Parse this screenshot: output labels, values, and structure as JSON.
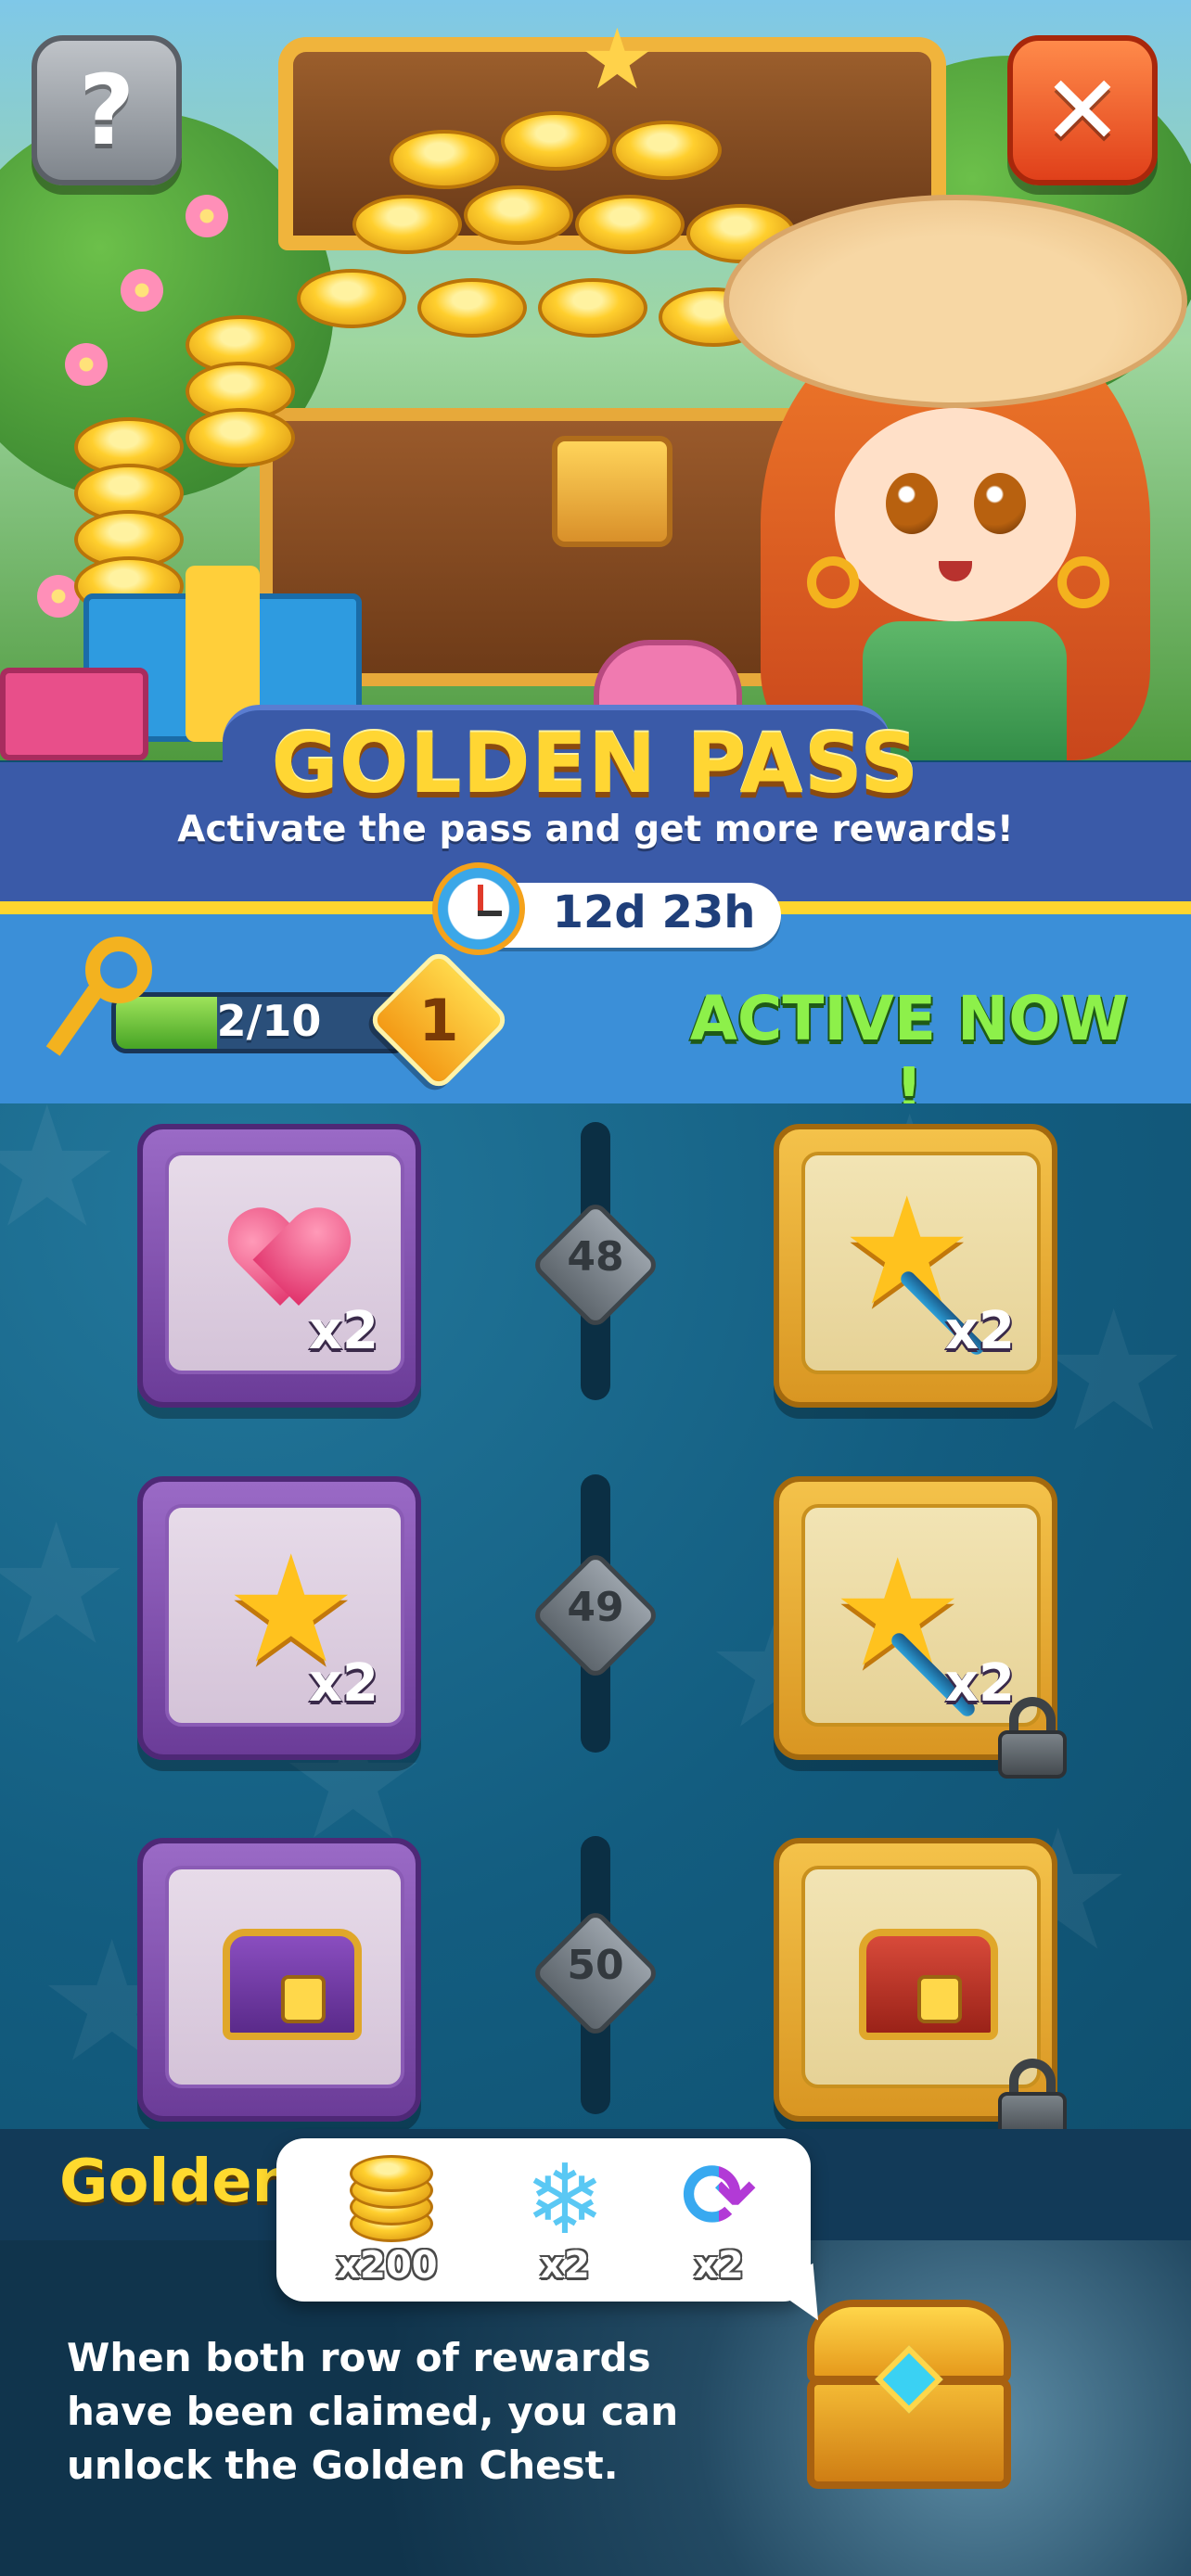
{
  "header": {
    "help_glyph": "?",
    "close_glyph": "✕",
    "title": "GOLDEN PASS",
    "subtitle": "Activate the pass and get more rewards!",
    "timer": "12d 23h"
  },
  "progress": {
    "keys_label": "2/10",
    "keys_fraction": 0.2,
    "level": "1",
    "status": "ACTIVE NOW !"
  },
  "rewards": [
    {
      "level": "48",
      "free": {
        "icon": "heart-icon",
        "qty": "x2"
      },
      "golden": {
        "icon": "star-wand-icon",
        "qty": "x2",
        "locked": false
      }
    },
    {
      "level": "49",
      "free": {
        "icon": "star-icon",
        "qty": "x2"
      },
      "golden": {
        "icon": "star-wand-icon",
        "qty": "x2",
        "locked": true
      }
    },
    {
      "level": "50",
      "free": {
        "icon": "purple-chest-icon",
        "qty": ""
      },
      "golden": {
        "icon": "red-chest-icon",
        "qty": "",
        "locked": true
      }
    }
  ],
  "golden_chest": {
    "label": "Golden",
    "description": "When both row of rewards have been claimed, you can unlock the Golden Chest.",
    "popup_items": [
      {
        "icon": "coins-icon",
        "qty": "x200"
      },
      {
        "icon": "snowflake-icon",
        "qty": "x2"
      },
      {
        "icon": "shuffle-icon",
        "qty": "x2"
      }
    ]
  },
  "colors": {
    "title_gold": "#ffd633",
    "banner_blue": "#3a5aa8",
    "active_green": "#8df04a",
    "free_tile_purple": "#9a6ac6",
    "gold_tile": "#f4c24a"
  }
}
